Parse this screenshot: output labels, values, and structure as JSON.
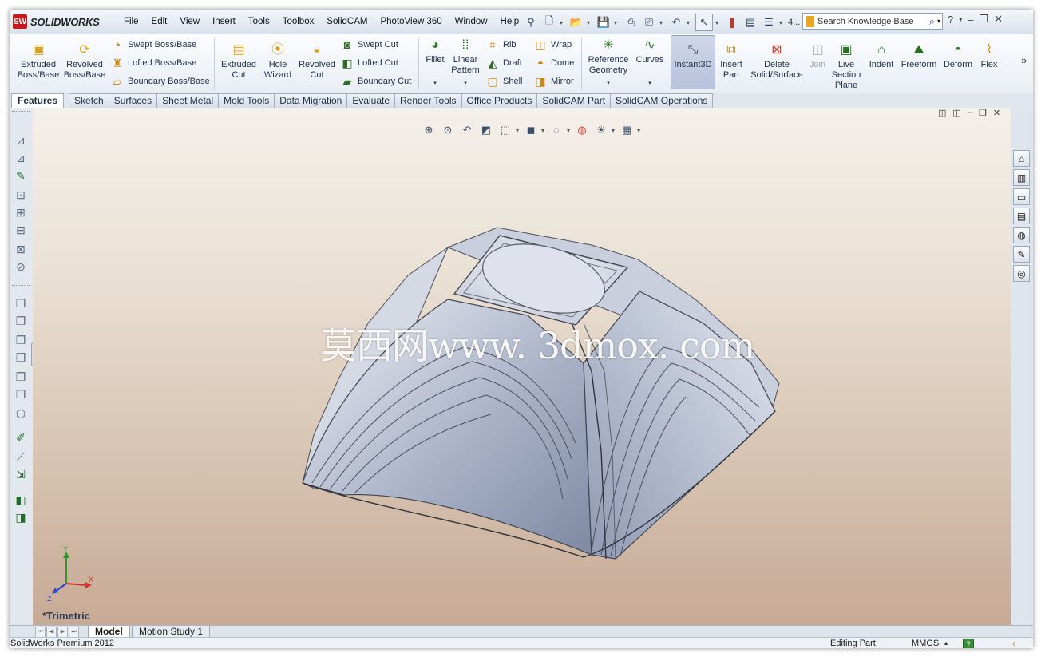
{
  "app": {
    "logo_text": "SOLIDWORKS",
    "logo_mark": "SW"
  },
  "menu": [
    "File",
    "Edit",
    "View",
    "Insert",
    "Tools",
    "Toolbox",
    "SolidCAM",
    "PhotoView 360",
    "Window",
    "Help"
  ],
  "quick_access": {
    "overflow_label": "4..."
  },
  "search": {
    "placeholder": "Search Knowledge Base"
  },
  "ribbon": {
    "extruded_boss": "Extruded Boss/Base",
    "revolved_boss": "Revolved Boss/Base",
    "swept_boss": "Swept Boss/Base",
    "lofted_boss": "Lofted Boss/Base",
    "boundary_boss": "Boundary Boss/Base",
    "extruded_cut": "Extruded Cut",
    "hole_wizard": "Hole Wizard",
    "revolved_cut": "Revolved Cut",
    "swept_cut": "Swept Cut",
    "lofted_cut": "Lofted Cut",
    "boundary_cut": "Boundary Cut",
    "fillet": "Fillet",
    "linear_pattern": "Linear Pattern",
    "rib": "Rib",
    "draft": "Draft",
    "shell": "Shell",
    "wrap": "Wrap",
    "dome": "Dome",
    "mirror": "Mirror",
    "reference_geometry": "Reference Geometry",
    "curves": "Curves",
    "instant3d": "Instant3D",
    "insert_part": "Insert Part",
    "delete_solid": "Delete Solid/Surface",
    "join": "Join",
    "live_section": "Live Section Plane",
    "indent": "Indent",
    "freeform": "Freeform",
    "deform": "Deform",
    "flex": "Flex"
  },
  "tabs": [
    "Features",
    "Sketch",
    "Surfaces",
    "Sheet Metal",
    "Mold Tools",
    "Data Migration",
    "Evaluate",
    "Render Tools",
    "Office Products",
    "SolidCAM Part",
    "SolidCAM Operations"
  ],
  "viewport": {
    "watermark": "莫西网www. 3dmox. com",
    "view_name": "*Trimetric",
    "triad": {
      "x": "X",
      "y": "Y",
      "z": "Z"
    }
  },
  "bottom_tabs": [
    "Model",
    "Motion Study 1"
  ],
  "status": {
    "product": "SolidWorks Premium 2012",
    "mode": "Editing Part",
    "units": "MMGS",
    "units_arrow": "▴",
    "help": "?"
  },
  "colors": {
    "part_fill": "#a9b3c9",
    "background_top": "#f4f0ea",
    "background_bottom": "#c7aa95",
    "accent_green": "#2d6f22"
  }
}
